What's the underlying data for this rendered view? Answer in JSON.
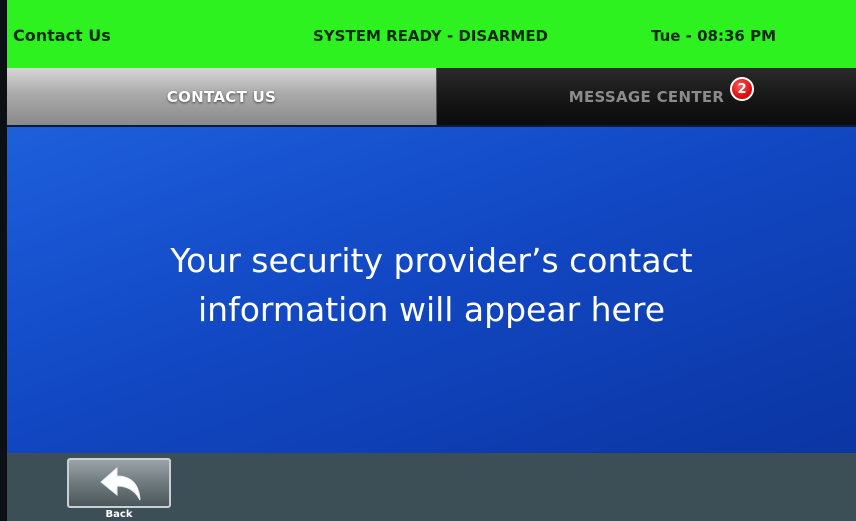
{
  "status_bar": {
    "title": "Contact Us",
    "system_state": "SYSTEM READY - DISARMED",
    "clock": "Tue - 08:36 PM"
  },
  "tabs": [
    {
      "label": "CONTACT US",
      "active": true
    },
    {
      "label": "MESSAGE CENTER",
      "active": false,
      "badge": "2"
    }
  ],
  "main": {
    "message_line1": "Your security provider’s contact",
    "message_line2": "information will appear here"
  },
  "footer": {
    "back_label": "Back",
    "back_icon": "back-arrow-icon"
  },
  "colors": {
    "status_bar": "#2ef21f",
    "main_panel": "#1248c4",
    "badge": "#e01010",
    "footer": "#3d4f56"
  }
}
